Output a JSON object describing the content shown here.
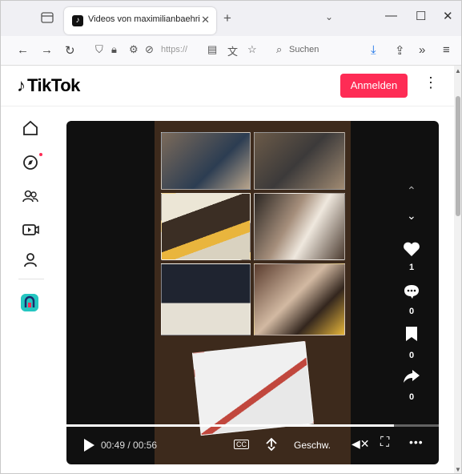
{
  "browser": {
    "tab": {
      "title": "Videos von maximilianbaehring",
      "favicon": "tiktok-favicon"
    },
    "window_controls": [
      "minimize",
      "maximize",
      "close"
    ],
    "urlbar": {
      "text": "https://"
    },
    "search": {
      "placeholder": "Suchen"
    }
  },
  "tiktok": {
    "logo_text": "TikTok",
    "login_label": "Anmelden",
    "brand_color": "#fe2c55",
    "sidebar": [
      {
        "name": "home-icon"
      },
      {
        "name": "explore-icon",
        "badge": true
      },
      {
        "name": "following-icon"
      },
      {
        "name": "live-tv-icon"
      },
      {
        "name": "profile-icon"
      },
      {
        "name": "live-creator-icon"
      }
    ]
  },
  "video": {
    "time": "00:49 / 00:56",
    "progress": 0.88,
    "captions_label": "CC",
    "speed_label": "Geschw.",
    "likes": "1",
    "comments": "0",
    "saves": "0",
    "shares": "0"
  }
}
